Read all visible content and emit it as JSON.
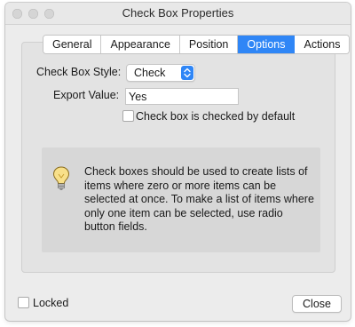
{
  "window": {
    "title": "Check Box Properties"
  },
  "tabs": [
    {
      "label": "General",
      "active": false
    },
    {
      "label": "Appearance",
      "active": false
    },
    {
      "label": "Position",
      "active": false
    },
    {
      "label": "Options",
      "active": true
    },
    {
      "label": "Actions",
      "active": false
    }
  ],
  "options": {
    "style_label": "Check Box Style:",
    "style_value": "Check",
    "export_label": "Export Value:",
    "export_value": "Yes",
    "default_checked_label": "Check box is checked by default",
    "default_checked": false
  },
  "info": {
    "icon": "lightbulb-icon",
    "text": "Check boxes should be used to create lists of items where zero or more items can be selected at once. To make a list of items where only one item can be selected, use radio button fields."
  },
  "footer": {
    "locked_label": "Locked",
    "locked": false,
    "close_label": "Close"
  },
  "colors": {
    "accent": "#2f86f6",
    "window_bg": "#ececec",
    "info_bg": "#d7d7d7"
  }
}
